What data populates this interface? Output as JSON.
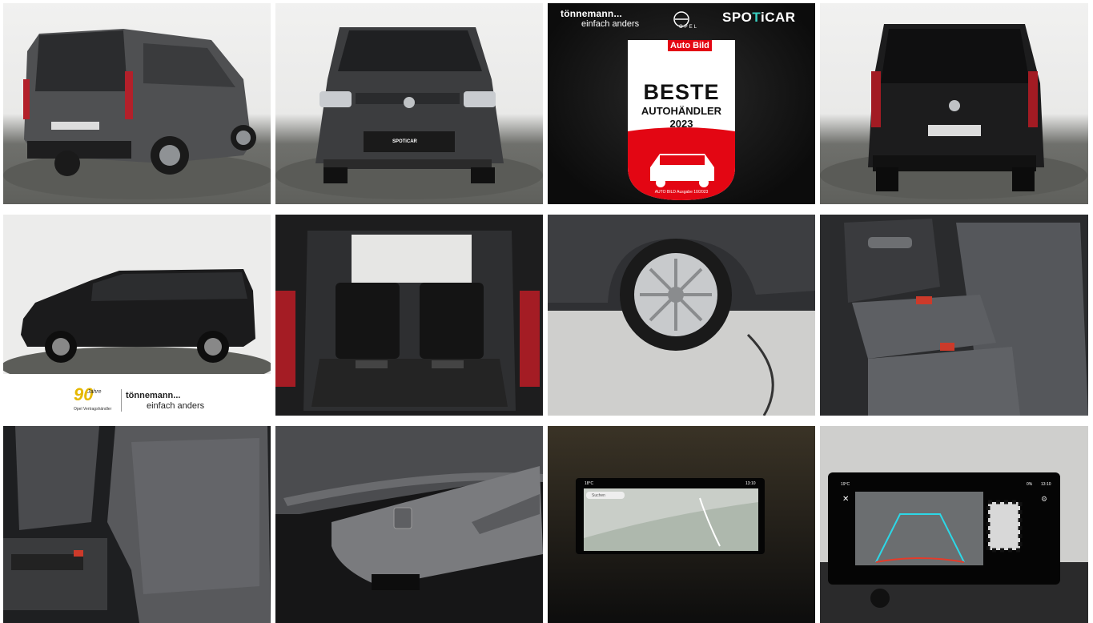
{
  "gallery": {
    "photos": [
      {
        "name": "photo-rear-three-quarter"
      },
      {
        "name": "photo-front"
      },
      {
        "name": "photo-dealer-badge"
      },
      {
        "name": "photo-rear"
      },
      {
        "name": "photo-side"
      },
      {
        "name": "photo-trunk"
      },
      {
        "name": "photo-wheel"
      },
      {
        "name": "photo-rear-seats"
      },
      {
        "name": "photo-front-seat"
      },
      {
        "name": "photo-seat-control"
      },
      {
        "name": "photo-navigation-screen"
      },
      {
        "name": "photo-rear-camera-screen"
      }
    ],
    "front_plate": "SPOTiCAR",
    "badge": {
      "dealer_name": "tönnemann...",
      "dealer_slogan": "einfach anders",
      "opel": "OPEL",
      "spoticar_left": "SPO",
      "spoticar_t": "T",
      "spoticar_right": "iCAR",
      "auto_bild": "Auto Bild",
      "beste": "BESTE",
      "autohaendler": "AUTOHÄNDLER",
      "year": "2023",
      "footnote": "AUTO BILD Ausgabe 10/2023"
    },
    "dealer_strip": {
      "ninety": "90",
      "jahre": "Jahre",
      "partner": "Opel Vertragshändler",
      "dealer_name": "tönnemann...",
      "dealer_slogan": "einfach anders"
    },
    "nav_screen": {
      "temp": "18°C",
      "time": "13:10",
      "search": "Suchen"
    },
    "camera_screen": {
      "temp": "19°C",
      "time": "13:10",
      "battery": "0%"
    }
  }
}
